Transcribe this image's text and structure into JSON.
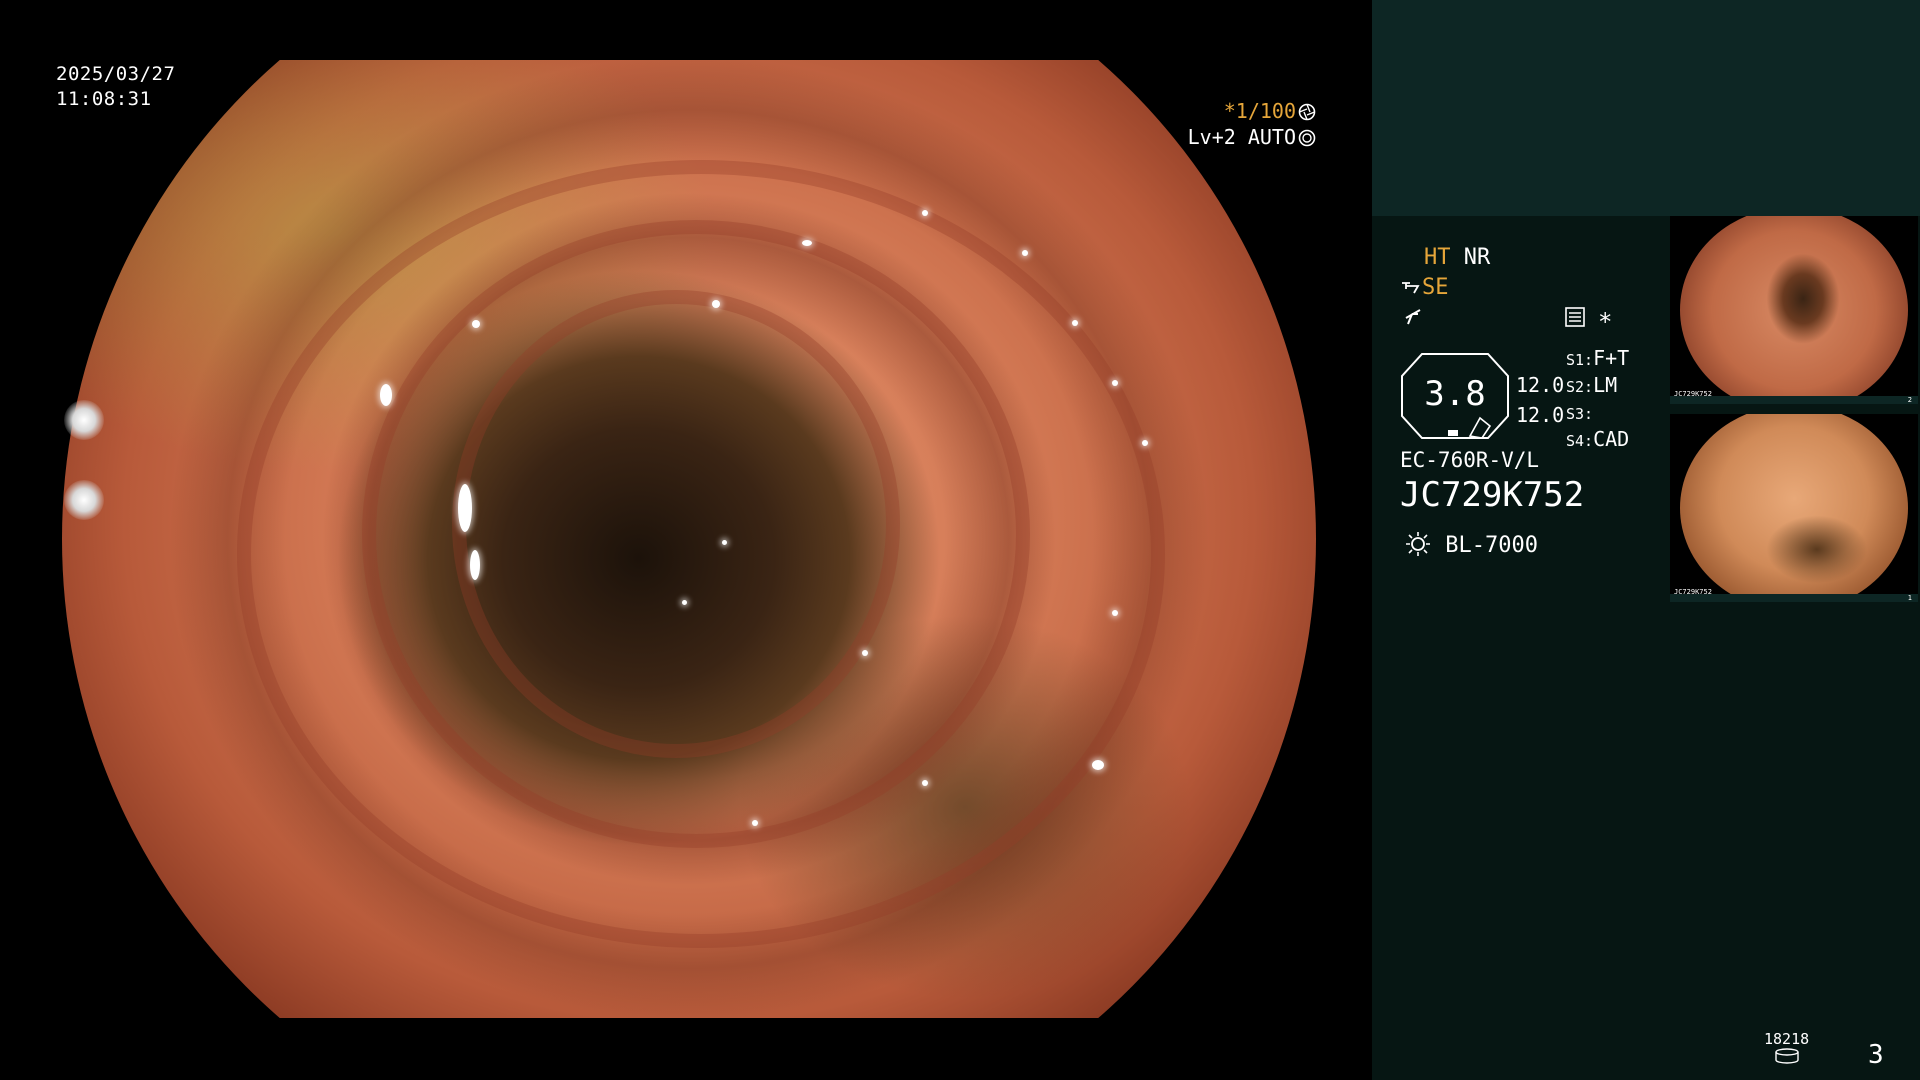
{
  "timestamp": {
    "date": "2025/03/27",
    "time": "11:08:31"
  },
  "shutter": {
    "speed": "*1/100",
    "level": "Lv+2",
    "mode": "AUTO"
  },
  "panel": {
    "ht": "HT",
    "nr": "NR",
    "se": "SE",
    "zoom": "3.8",
    "value_1": "12.0",
    "value_2": "12.0",
    "switches": [
      {
        "key": "S1:",
        "value": "F+T"
      },
      {
        "key": "S2:",
        "value": "LM"
      },
      {
        "key": "S3:",
        "value": ""
      },
      {
        "key": "S4:",
        "value": "CAD"
      }
    ],
    "scope_model": "EC-760R-V/L",
    "scope_serial": "JC729K752",
    "light_source": "BL-7000",
    "star": "*"
  },
  "thumbnails": [
    {
      "stamp": "JC729K752",
      "number": "2"
    },
    {
      "stamp": "JC729K752",
      "number": "1"
    }
  ],
  "footer": {
    "counter": "18218",
    "page": "3"
  },
  "colors": {
    "accent": "#e6a63a",
    "panel_bg": "#061613",
    "panel_top": "#0d2624"
  },
  "icons": [
    "shutter-icon",
    "auto-iris-icon",
    "se-mode-icon",
    "cable-icon",
    "settings-icon",
    "light-bulb-icon",
    "disk-icon"
  ]
}
